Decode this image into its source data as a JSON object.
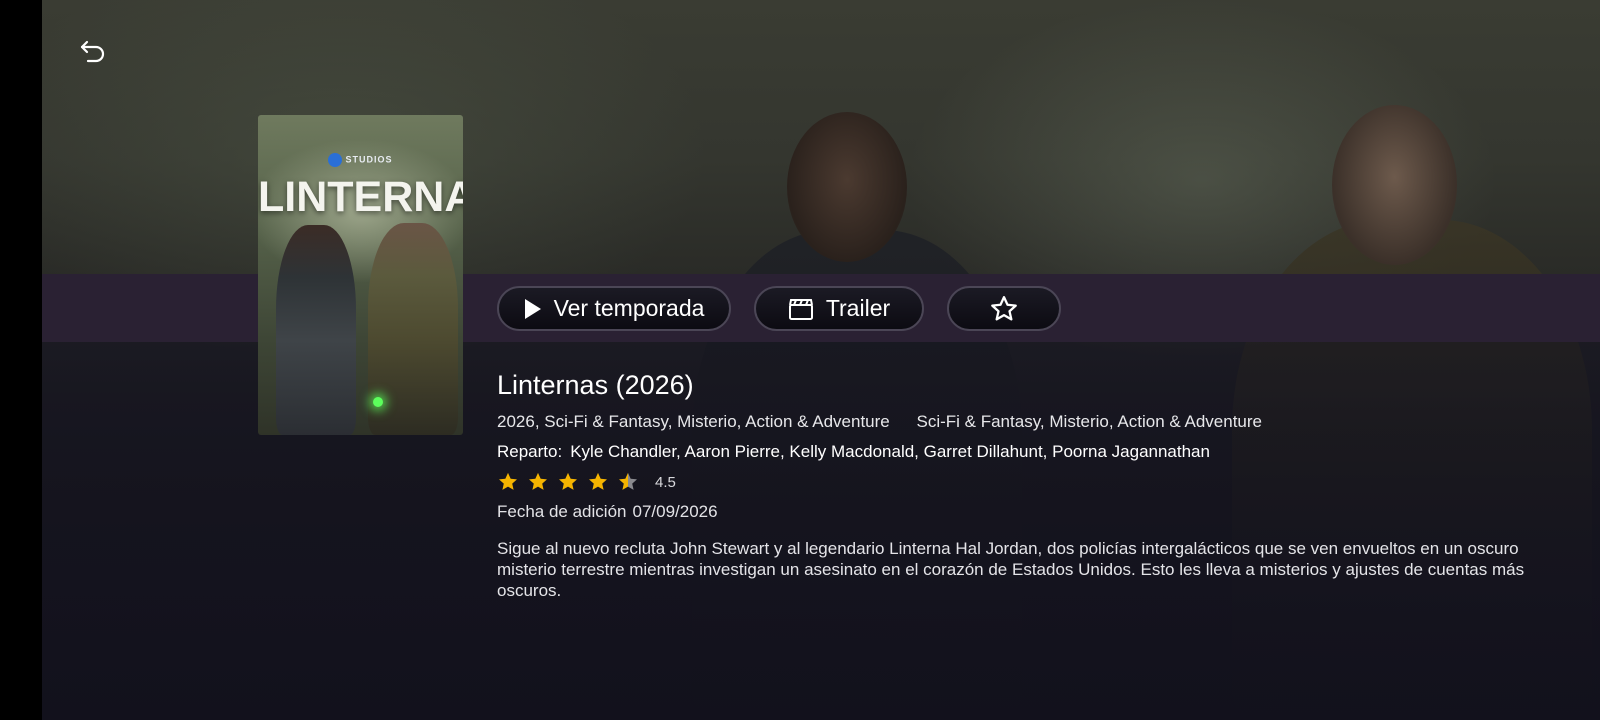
{
  "colors": {
    "accent_star": "#f5b400",
    "band": "#2a2133",
    "background": "#141320"
  },
  "nav": {
    "back_icon": "back-arrow-icon"
  },
  "poster": {
    "studio_label": "STUDIOS",
    "title_text": "LINTERNAS"
  },
  "actions": {
    "play_label": "Ver temporada",
    "play_icon": "play-icon",
    "trailer_label": "Trailer",
    "trailer_icon": "clapperboard-icon",
    "favorite_icon": "star-outline-icon"
  },
  "details": {
    "title": "Linternas (2026)",
    "meta_year_genres": "2026, Sci-Fi & Fantasy, Misterio, Action & Adventure",
    "meta_genres": "Sci-Fi & Fantasy, Misterio, Action & Adventure",
    "cast_label": "Reparto:",
    "cast": "Kyle Chandler, Aaron Pierre, Kelly Macdonald, Garret Dillahunt, Poorna Jagannathan",
    "rating_value": "4.5",
    "rating_stars": 4.5,
    "rating_max": 5,
    "added_label": "Fecha de adición",
    "added_date": "07/09/2026",
    "description": "Sigue al nuevo recluta John Stewart y al legendario Linterna Hal Jordan, dos policías intergalácticos que se ven envueltos en un oscuro misterio terrestre mientras investigan un asesinato en el corazón de Estados Unidos. Esto les lleva a misterios y ajustes de cuentas más oscuros."
  }
}
